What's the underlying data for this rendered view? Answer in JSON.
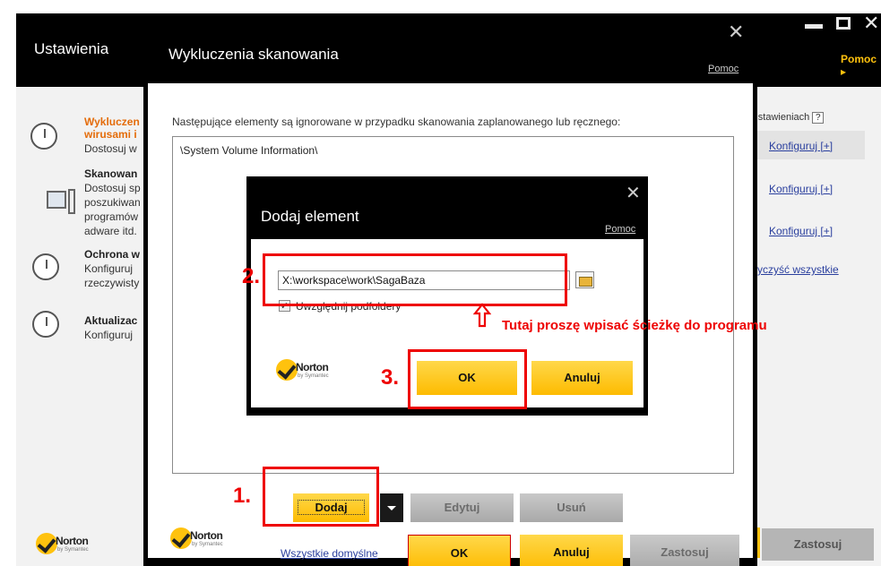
{
  "back_window": {
    "title": "Ustawienia",
    "help": "Pomoc ▸",
    "items": [
      {
        "line1": "Wykluczen",
        "line2": "wirusami i",
        "line3": "Dostosuj w"
      },
      {
        "line1": "Skanowan",
        "line2": "Dostosuj sp",
        "line3": "poszukiwan",
        "line4": "programów",
        "line5": "adware itd."
      },
      {
        "line1": "Ochrona w",
        "line2": "Konfiguruj",
        "line3": "rzeczywisty"
      },
      {
        "line1": "Aktualizac",
        "line2": "Konfiguruj"
      }
    ],
    "right_header": "ch ustawieniach",
    "help_mark": "?",
    "links": [
      "Konfiguruj [+]",
      "Konfiguruj [+]",
      "Konfiguruj [+]",
      "yczyść wszystkie"
    ],
    "zastosuj": "Zastosuj"
  },
  "norton": {
    "brand": "Norton",
    "sub": "by Symantec"
  },
  "scan_exclusions": {
    "title": "Wykluczenia skanowania",
    "help": "Pomoc",
    "description": "Następujące elementy są ignorowane w przypadku skanowania zaplanowanego lub ręcznego:",
    "items": [
      "\\System Volume Information\\"
    ],
    "add": "Dodaj",
    "edit": "Edytuj",
    "remove": "Usuń",
    "defaults": "Wszystkie domyślne",
    "ok": "OK",
    "cancel": "Anuluj",
    "apply": "Zastosuj"
  },
  "add_element": {
    "title": "Dodaj element",
    "help": "Pomoc",
    "path_value": "X:\\workspace\\work\\SagaBaza",
    "include_subfolders": "Uwzględnij podfoldery",
    "ok": "OK",
    "cancel": "Anuluj"
  },
  "annotations": {
    "step1": "1.",
    "step2": "2.",
    "step3": "3.",
    "hint": "Tutaj proszę wpisać ścieżkę do programu"
  },
  "colors": {
    "accent": "#ffc20e",
    "annotation": "#e00000",
    "link": "#2a3f9e"
  }
}
